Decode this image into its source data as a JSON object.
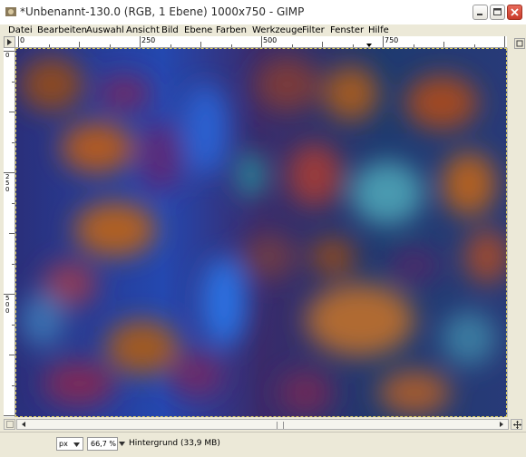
{
  "window": {
    "title": "*Unbenannt-130.0 (RGB, 1 Ebene) 1000x750 - GIMP"
  },
  "menu": [
    "Datei",
    "Bearbeiten",
    "Auswahl",
    "Ansicht",
    "Bild",
    "Ebene",
    "Farben",
    "Werkzeuge",
    "Filter",
    "Fenster",
    "Hilfe"
  ],
  "ruler": {
    "h_labels": [
      "0",
      "250",
      "500",
      "750"
    ],
    "v_labels": [
      "0",
      "250",
      "500"
    ]
  },
  "status": {
    "unit": "px",
    "zoom": "66,7 %",
    "layer_info": "Hintergrund (33,9 MB)"
  },
  "colors": {
    "titlebar_bg": "#ffffff",
    "chrome_bg": "#ece9d8",
    "close_button": "#d13d3d"
  }
}
